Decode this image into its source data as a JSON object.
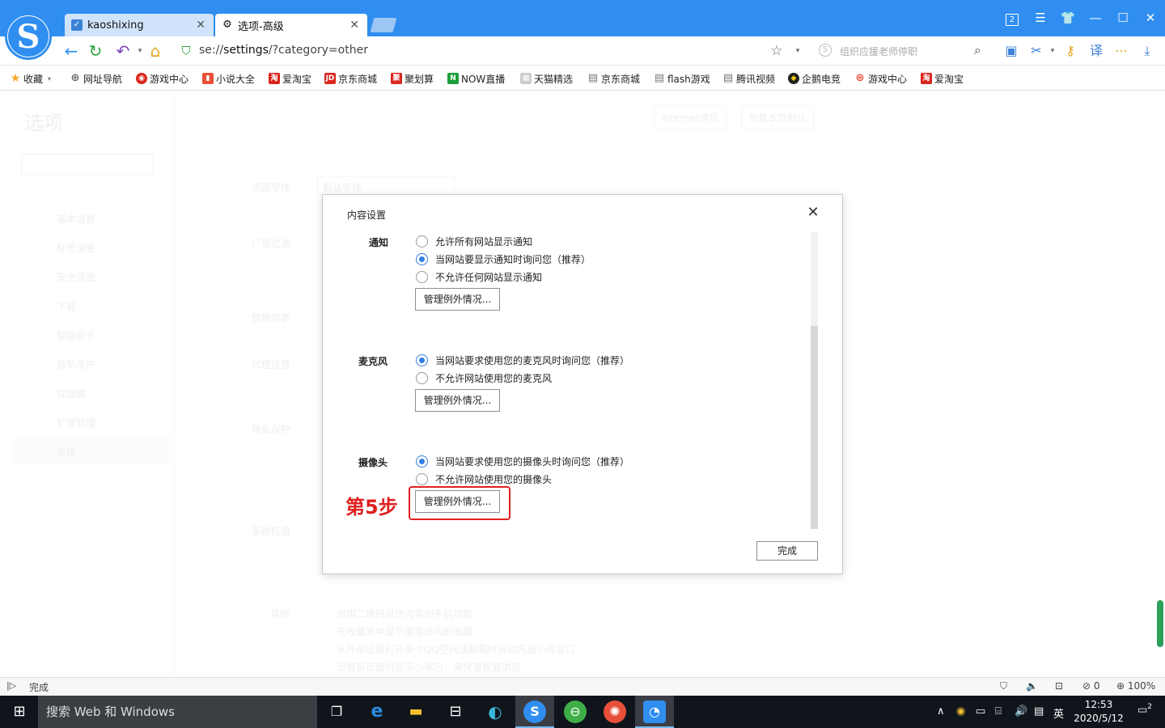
{
  "browser": {
    "tabs": [
      {
        "label": "kaoshixing",
        "icon": "kaoshixing-icon"
      },
      {
        "label": "选项-高级",
        "icon": "gear-icon"
      }
    ],
    "tab_count_badge": "2",
    "url_prefix": "se://",
    "url_path": "settings",
    "url_query": "/?category=other",
    "search_placeholder": "组织应援老师停职"
  },
  "bookmarks": [
    {
      "label": "收藏",
      "icon": "star-icon",
      "color": "#f5a623"
    },
    {
      "label": "网址导航",
      "icon": "globe-icon",
      "color": "#666666"
    },
    {
      "label": "游戏中心",
      "icon": "game-icon",
      "color": "#d9251d"
    },
    {
      "label": "小说大全",
      "icon": "book-icon",
      "color": "#e8503a"
    },
    {
      "label": "爱淘宝",
      "icon": "taobao-icon",
      "color": "#d9251d"
    },
    {
      "label": "京东商城",
      "icon": "jd-icon",
      "color": "#d9251d"
    },
    {
      "label": "聚划算",
      "icon": "juhuasuan-icon",
      "color": "#d9251d"
    },
    {
      "label": "NOW直播",
      "icon": "now-icon",
      "color": "#1a9e3a"
    },
    {
      "label": "天猫精选",
      "icon": "tmall-icon",
      "color": "#bbbbbb"
    },
    {
      "label": "京东商城",
      "icon": "page-icon",
      "color": "#777777"
    },
    {
      "label": "flash游戏",
      "icon": "page-icon",
      "color": "#777777"
    },
    {
      "label": "腾讯视频",
      "icon": "page-icon",
      "color": "#777777"
    },
    {
      "label": "企鹅电竞",
      "icon": "penguin-icon",
      "color": "#222222"
    },
    {
      "label": "游戏中心",
      "icon": "gamepad-icon",
      "color": "#e8503a"
    },
    {
      "label": "爱淘宝",
      "icon": "taobao-icon",
      "color": "#d9251d"
    }
  ],
  "dialog": {
    "title": "内容设置",
    "sections": {
      "notify": {
        "title": "通知",
        "options": [
          "允许所有网站显示通知",
          "当网站要显示通知时询问您（推荐）",
          "不允许任何网站显示通知"
        ],
        "selected": 1,
        "button": "管理例外情况..."
      },
      "mic": {
        "title": "麦克风",
        "options": [
          "当网站要求使用您的麦克风时询问您（推荐）",
          "不允许网站使用您的麦克风"
        ],
        "selected": 0,
        "button": "管理例外情况..."
      },
      "camera": {
        "title": "摄像头",
        "options": [
          "当网站要求使用您的摄像头时询问您（推荐）",
          "不允许网站使用您的摄像头"
        ],
        "selected": 0,
        "button": "管理例外情况..."
      }
    },
    "done_button": "完成",
    "step_label": "第5步"
  },
  "background_page": {
    "title": "选项",
    "buttons": [
      "Internet选项",
      "恢复本页默认"
    ],
    "sidebar": [
      "基本设置",
      "标签设置",
      "安全设置",
      "下载",
      "智能助手",
      "隐私保护",
      "快捷键",
      "扩展管理",
      "高级"
    ],
    "labels": [
      "页面字体",
      "默认字体",
      "广告过滤",
      "智能填表",
      "代理设置",
      "隐私保护",
      "系统托盘",
      "其他"
    ],
    "other_options": [
      "启用二维码发送内容到手机功能",
      "在收藏夹中显示最常访问的收藏",
      "从外部链接打开多个QQ空间或邮箱时自动开启小号窗口",
      "没有新页面时显示小尾巴，来快速恢复浏览"
    ]
  },
  "statusbar": {
    "status": "完成",
    "ad_count": "0",
    "zoom": "100%"
  },
  "taskbar": {
    "search_placeholder": "搜索 Web 和 Windows",
    "ime": "英",
    "time": "12:53",
    "date": "2020/5/12",
    "notification_count": "2"
  }
}
